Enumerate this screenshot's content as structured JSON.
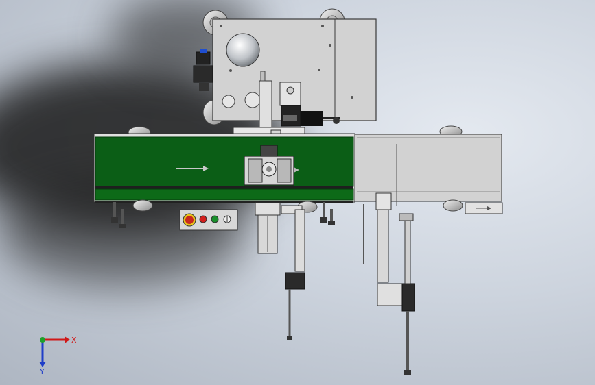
{
  "triad": {
    "x_label": "X",
    "y_label": "Y",
    "x_color": "#d01818",
    "y_color": "#1f3ec8",
    "origin_color": "#1fa02a"
  },
  "colors": {
    "belt_green": "#0b5e16",
    "machine_gray": "#d4d4d4",
    "outline": "#3a3a3a",
    "stop_button": "#c8281e",
    "red_button": "#d2201e",
    "green_button": "#1a8f2c"
  },
  "icons": {
    "flow_arrow": "right-arrow-icon",
    "view_triad": "axis-triad-icon"
  }
}
